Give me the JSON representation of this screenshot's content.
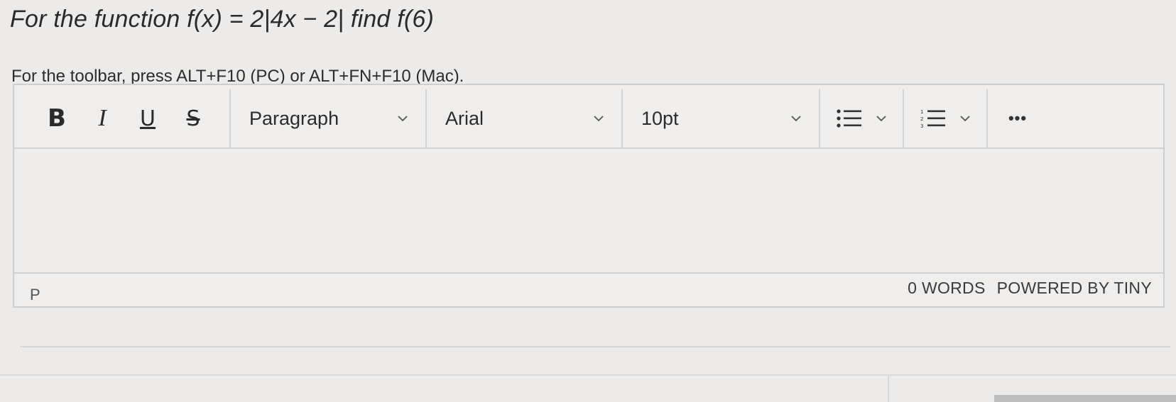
{
  "question": {
    "prefix": "For the function ",
    "equation": "f(x) = 2|4x − 2|",
    "middle": " find ",
    "target": "f(6)"
  },
  "editor": {
    "toolbar_hint": "For the toolbar, press ALT+F10 (PC) or ALT+FN+F10 (Mac).",
    "format_buttons": {
      "bold": "B",
      "italic": "I",
      "underline": "U",
      "strikethrough": "S"
    },
    "block_format": "Paragraph",
    "font_family": "Arial",
    "font_size": "10pt",
    "more": "•••",
    "status": {
      "path": "P",
      "word_count": "0 WORDS",
      "powered_by": "POWERED BY TINY"
    }
  },
  "icons": {
    "bullet_list": "bullet-list-icon",
    "numbered_list": "numbered-list-icon",
    "chevron": "chevron-down-icon",
    "more": "more-icon"
  }
}
